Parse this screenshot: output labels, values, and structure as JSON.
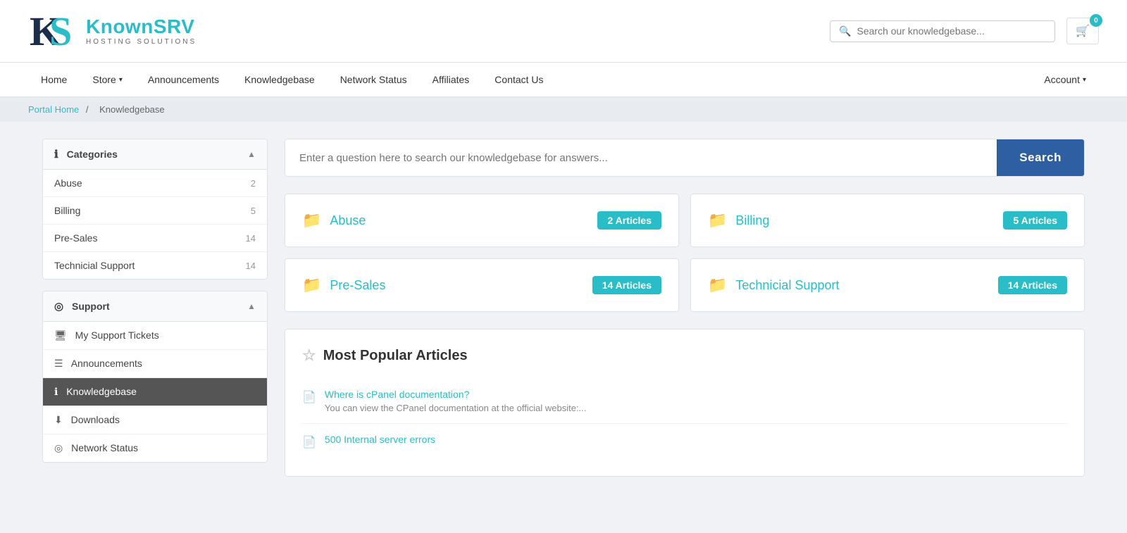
{
  "header": {
    "logo": {
      "letters": "KS",
      "brand_text": "Known",
      "brand_accent": "SRV",
      "sub": "HOSTING SOLUTIONS"
    },
    "search_placeholder": "Search our knowledgebase...",
    "cart_count": "0"
  },
  "nav": {
    "items": [
      {
        "label": "Home",
        "has_dropdown": false
      },
      {
        "label": "Store",
        "has_dropdown": true
      },
      {
        "label": "Announcements",
        "has_dropdown": false
      },
      {
        "label": "Knowledgebase",
        "has_dropdown": false
      },
      {
        "label": "Network Status",
        "has_dropdown": false
      },
      {
        "label": "Affiliates",
        "has_dropdown": false
      },
      {
        "label": "Contact Us",
        "has_dropdown": false
      }
    ],
    "account_label": "Account"
  },
  "breadcrumb": {
    "portal_home": "Portal Home",
    "separator": "/",
    "current": "Knowledgebase"
  },
  "sidebar": {
    "categories_title": "Categories",
    "categories": [
      {
        "name": "Abuse",
        "count": "2"
      },
      {
        "name": "Billing",
        "count": "5"
      },
      {
        "name": "Pre-Sales",
        "count": "14"
      },
      {
        "name": "Technicial Support",
        "count": "14"
      }
    ],
    "support_title": "Support",
    "support_items": [
      {
        "icon": "🖥",
        "label": "My Support Tickets"
      },
      {
        "icon": "☰",
        "label": "Announcements"
      },
      {
        "icon": "ℹ",
        "label": "Knowledgebase",
        "active": true
      },
      {
        "icon": "⬇",
        "label": "Downloads"
      },
      {
        "icon": "◎",
        "label": "Network Status"
      }
    ]
  },
  "kb_search": {
    "placeholder": "Enter a question here to search our knowledgebase for answers...",
    "button_label": "Search"
  },
  "categories": [
    {
      "name": "Abuse",
      "articles": "2 Articles"
    },
    {
      "name": "Billing",
      "articles": "5 Articles"
    },
    {
      "name": "Pre-Sales",
      "articles": "14 Articles"
    },
    {
      "name": "Technicial Support",
      "articles": "14 Articles"
    }
  ],
  "popular": {
    "title": "Most Popular Articles",
    "articles": [
      {
        "title": "Where is cPanel documentation?",
        "desc": "You can view the CPanel documentation at the official website:..."
      },
      {
        "title": "500 Internal server errors",
        "desc": ""
      }
    ]
  }
}
